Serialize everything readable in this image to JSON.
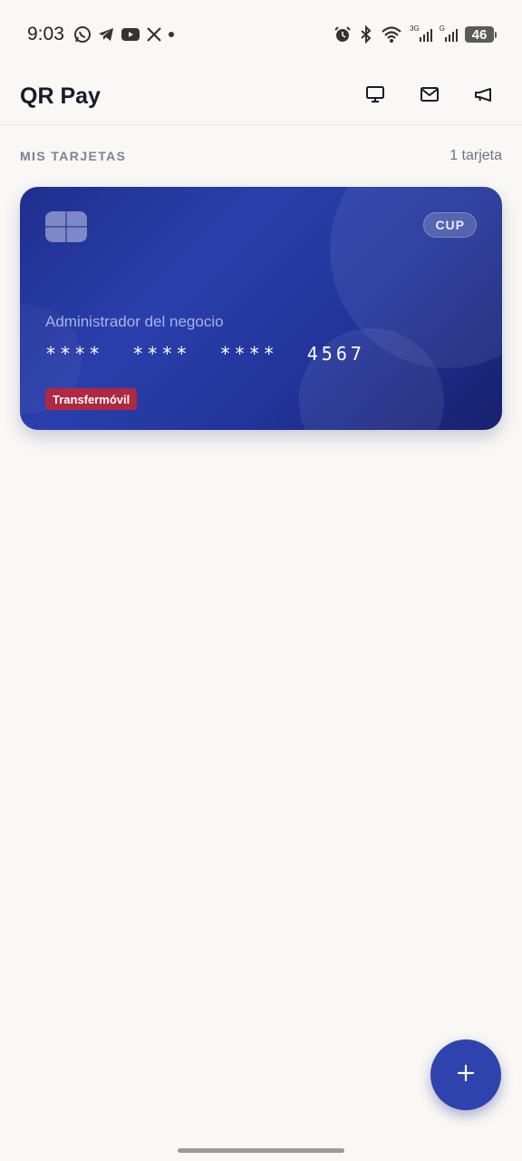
{
  "status_bar": {
    "time": "9:03",
    "notification_icons": [
      "whatsapp-icon",
      "telegram-icon",
      "youtube-icon",
      "x-icon",
      "dot-icon"
    ],
    "system_icons": [
      "alarm-icon",
      "bluetooth-icon",
      "wifi-icon",
      "signal-3g-icon",
      "signal-g-icon"
    ],
    "net_label_1": "3G",
    "net_label_2": "G",
    "battery": "46"
  },
  "app_bar": {
    "title": "QR Pay",
    "actions": [
      "monitor-icon",
      "mail-icon",
      "megaphone-icon"
    ]
  },
  "section": {
    "title": "MIS TARJETAS",
    "count": "1 tarjeta"
  },
  "card": {
    "currency": "CUP",
    "holder": "Administrador del negocio",
    "number": "****  ****  ****  4567",
    "provider": "Transfermóvil",
    "colors": {
      "gradient_start": "#1f2f8e",
      "gradient_end": "#16206d",
      "provider_badge": "#b02842"
    }
  },
  "fab": {
    "icon": "plus-icon",
    "color": "#2e43ad"
  }
}
